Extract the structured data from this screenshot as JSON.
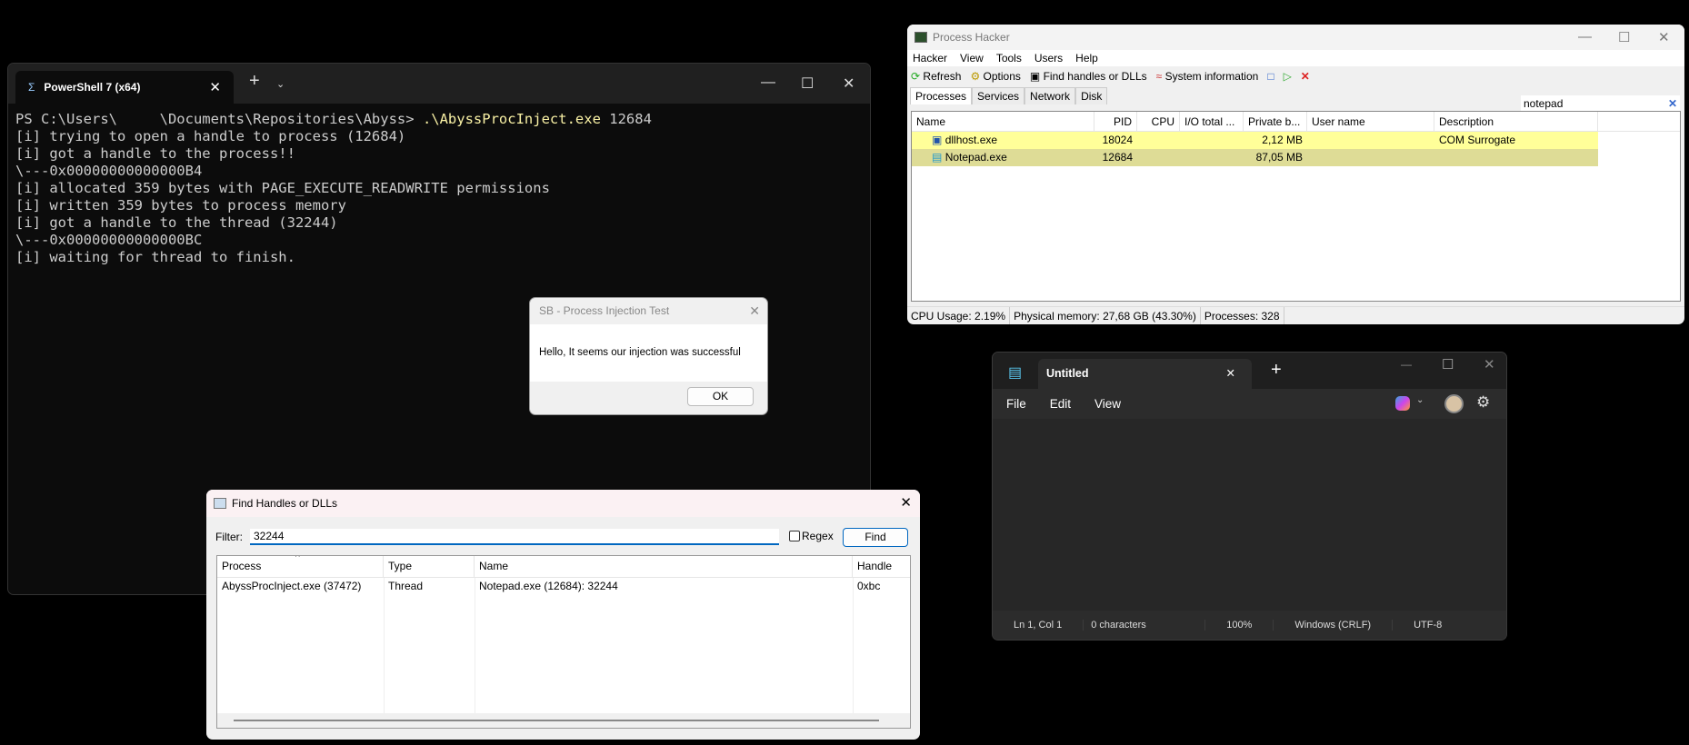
{
  "powershell": {
    "tab_title": "PowerShell 7 (x64)",
    "prompt": "PS C:\\Users\\     \\Documents\\Repositories\\Abyss> ",
    "command": ".\\AbyssProcInject.exe",
    "arg": " 12684",
    "lines": [
      "[i] trying to open a handle to process (12684)",
      "[i] got a handle to the process!!",
      "\\---0x00000000000000B4",
      "[i] allocated 359 bytes with PAGE_EXECUTE_READWRITE permissions",
      "[i] written 359 bytes to process memory",
      "[i] got a handle to the thread (32244)",
      "\\---0x00000000000000BC",
      "[i] waiting for thread to finish."
    ]
  },
  "process_hacker": {
    "title": "Process Hacker",
    "menu": [
      "Hacker",
      "View",
      "Tools",
      "Users",
      "Help"
    ],
    "toolbar": {
      "refresh": "Refresh",
      "options": "Options",
      "find": "Find handles or DLLs",
      "sysinfo": "System information"
    },
    "search": "notepad",
    "tabs": [
      "Processes",
      "Services",
      "Network",
      "Disk"
    ],
    "columns": [
      "Name",
      "PID",
      "CPU",
      "I/O total ...",
      "Private b...",
      "User name",
      "Description"
    ],
    "rows": [
      {
        "name": "dllhost.exe",
        "pid": "18024",
        "cpu": "",
        "io": "",
        "private": "2,12 MB",
        "user": "",
        "desc": "COM Surrogate"
      },
      {
        "name": "Notepad.exe",
        "pid": "12684",
        "cpu": "",
        "io": "",
        "private": "87,05 MB",
        "user": "",
        "desc": ""
      }
    ],
    "status": {
      "cpu": "CPU Usage: 2.19%",
      "mem": "Physical memory: 27,68 GB (43.30%)",
      "procs": "Processes: 328"
    },
    "colors": {
      "row1": "#ffff99",
      "row2": "#dedc96"
    }
  },
  "dialog": {
    "title": "SB - Process Injection Test",
    "message": "Hello, It seems our injection was successful",
    "ok": "OK"
  },
  "find_handles": {
    "title": "Find Handles or DLLs",
    "filter_label": "Filter:",
    "filter_value": "32244",
    "regex": "Regex",
    "find": "Find",
    "columns": [
      "Process",
      "Type",
      "Name",
      "Handle"
    ],
    "rows": [
      {
        "process": "AbyssProcInject.exe (37472)",
        "type": "Thread",
        "name": "Notepad.exe (12684): 32244",
        "handle": "0xbc"
      }
    ]
  },
  "notepad": {
    "tab": "Untitled",
    "menu": [
      "File",
      "Edit",
      "View"
    ],
    "status": [
      "Ln 1, Col 1",
      "0 characters",
      "100%",
      "Windows (CRLF)",
      "UTF-8"
    ]
  }
}
